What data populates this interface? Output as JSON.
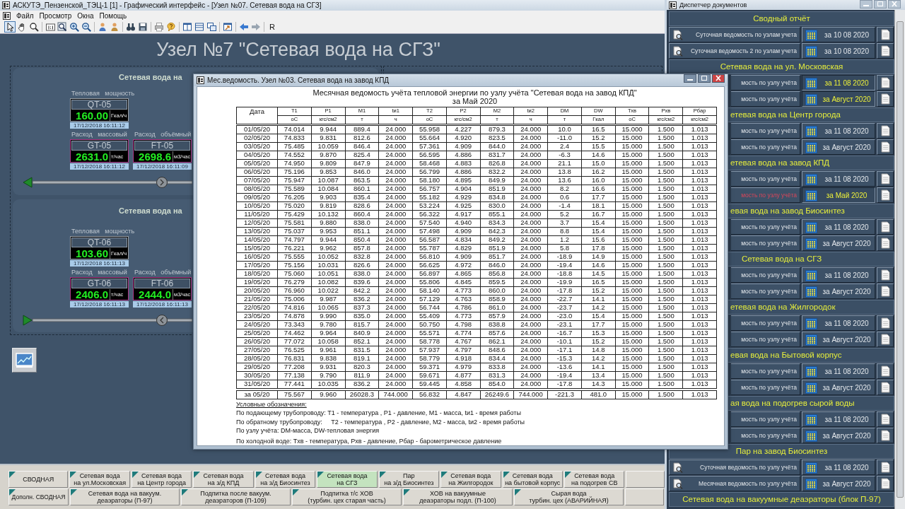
{
  "main_window": {
    "title": "АСКУТЭ_Пензенской_ТЭЦ-1 [1] - Графический интерфейс - [Узел №07. Сетевая вода на СГЗ]",
    "menu": [
      "Файл",
      "Просмотр",
      "Окна",
      "Помощь"
    ],
    "toolbar": [
      [
        {
          "kind": "pointer",
          "selected": true
        },
        {
          "kind": "hand",
          "selected": false
        },
        {
          "kind": "zoom",
          "selected": false
        }
      ],
      [
        {
          "kind": "actual",
          "selected": false
        },
        {
          "kind": "fit",
          "selected": false
        },
        {
          "kind": "zoom_in",
          "selected": false
        },
        {
          "kind": "zoom_out",
          "selected": false
        }
      ],
      [
        {
          "kind": "user_up",
          "selected": false
        },
        {
          "kind": "user_down",
          "selected": false
        }
      ],
      [
        {
          "kind": "binoculars",
          "selected": false
        },
        {
          "kind": "save",
          "selected": false
        }
      ],
      [
        {
          "kind": "print",
          "selected": false
        },
        {
          "kind": "help",
          "selected": false
        }
      ],
      [
        {
          "kind": "split_v",
          "selected": false
        },
        {
          "kind": "split_h",
          "selected": false
        },
        {
          "kind": "windows",
          "selected": false
        }
      ],
      [
        {
          "kind": "check",
          "selected": false
        }
      ],
      [
        {
          "kind": "back",
          "selected": false
        },
        {
          "kind": "forward",
          "selected": false
        }
      ]
    ],
    "toolbar_text_button": "R",
    "heading": "Узел №7 \"Сетевая вода на СГЗ\"",
    "panels": [
      {
        "heading": "Сетевая вода на",
        "kind": "leftward",
        "meters": [
          {
            "kind": "power",
            "caption": "Тепловая   мощность",
            "tag": "QT-05",
            "value": "160.00",
            "unit": "Гкал/ч",
            "time": "17/12/2018 16:11:12"
          },
          {
            "kind": "flow",
            "caption": "Расход   массовый",
            "tag": "GT-05",
            "value": "2631.0",
            "unit": "т/час",
            "time": "17/12/2018 16:11:12"
          },
          {
            "kind": "flow",
            "caption": "Расход   объёмный",
            "tag": "FT-05",
            "value": "2698.6",
            "unit": "м3/час",
            "time": "17/12/2018 16:11:09"
          }
        ]
      },
      {
        "heading": "Сетевая вода на",
        "kind": "rightward",
        "meters": [
          {
            "kind": "power",
            "caption": "Тепловая   мощность",
            "tag": "QT-06",
            "value": "103.60",
            "unit": "Гкал/ч",
            "time": "17/12/2018 16:11:13"
          },
          {
            "kind": "flow",
            "caption": "Расход   массовый",
            "tag": "GT-06",
            "value": "2406.0",
            "unit": "т/час",
            "time": "17/12/2018 16:11:13"
          },
          {
            "kind": "flow",
            "caption": "Расход   объёмный",
            "tag": "FT-06",
            "value": "2444.0",
            "unit": "м3/час",
            "time": "17/12/2018 16:11:13"
          }
        ]
      }
    ],
    "tab_rows": [
      [
        {
          "label": "СВОДНАЯ",
          "selected": false
        },
        {
          "label": "Сетевая вода\nна ул.Московская",
          "selected": false
        },
        {
          "label": "Сетевая вода\nна Центр города",
          "selected": false
        },
        {
          "label": "Сетевая вода\nна з/д КПД",
          "selected": false
        },
        {
          "label": "Сетевая вода\nна з/д Биосинтез",
          "selected": false
        },
        {
          "label": "Сетевая вода\nна СГЗ",
          "selected": true
        },
        {
          "label": "Пар\nна з/д Биосинтез",
          "selected": false
        },
        {
          "label": "Сетевая вода\nна Жилгородок",
          "selected": false
        },
        {
          "label": "Сетевая вода\nна бытовой корпус",
          "selected": false
        },
        {
          "label": "Сетевая вода\nна подогрев СВ",
          "selected": false
        }
      ],
      [
        {
          "label": "Дополн. СВОДНАЯ",
          "selected": false
        },
        {
          "label": "Сетевая вода на вакуум.\nдеаэраторы (П-97)",
          "selected": false
        },
        {
          "label": "Подпитка после вакуум.\nдеаэраторов (П-109)",
          "selected": false
        },
        {
          "label": "Подпитка т/с ХОВ\n(турбин. цех старая часть)",
          "selected": false
        },
        {
          "label": "ХОВ на вакуумные\nдеаэраторы подл. (П-100)",
          "selected": false
        },
        {
          "label": "Сырая вода\nтурбин. цех (АВАРИЙНАЯ)",
          "selected": false
        }
      ]
    ]
  },
  "report_window": {
    "title": "Мес.ведомость. Узел №03. Сетевая вода на завод КПД",
    "heading": "Месячная ведомость учёта тепловой энергии по узлу учёта \"Сетевая вода на завод КПД\"",
    "period": "за Май 2020",
    "columns": [
      {
        "name": "Дата"
      },
      {
        "name": "T1",
        "unit": "оС"
      },
      {
        "name": "P1",
        "unit": "кгс/см2"
      },
      {
        "name": "M1",
        "unit": "т"
      },
      {
        "name": "tи1",
        "unit": "ч"
      },
      {
        "name": "T2",
        "unit": "оС"
      },
      {
        "name": "P2",
        "unit": "кгс/см2"
      },
      {
        "name": "M2",
        "unit": "т"
      },
      {
        "name": "tи2",
        "unit": "ч"
      },
      {
        "name": "DM",
        "unit": "т"
      },
      {
        "name": "DW",
        "unit": "Гкал"
      },
      {
        "name": "Тхв",
        "unit": "оС"
      },
      {
        "name": "Рхв",
        "unit": "кгс/см2"
      },
      {
        "name": "Рбар",
        "unit": "кгс/см2"
      }
    ],
    "rows": [
      [
        "01/05/20",
        "74.014",
        "9.944",
        "889.4",
        "24.000",
        "55.958",
        "4.227",
        "879.3",
        "24.000",
        "10.0",
        "16.5",
        "15.000",
        "1.500",
        "1.013"
      ],
      [
        "02/05/20",
        "74.833",
        "9.831",
        "812.6",
        "24.000",
        "55.664",
        "4.920",
        "823.5",
        "24.000",
        "-11.0",
        "15.2",
        "15.000",
        "1.500",
        "1.013"
      ],
      [
        "03/05/20",
        "75.485",
        "10.059",
        "846.4",
        "24.000",
        "57.361",
        "4.909",
        "844.0",
        "24.000",
        "2.4",
        "15.5",
        "15.000",
        "1.500",
        "1.013"
      ],
      [
        "04/05/20",
        "74.552",
        "9.870",
        "825.4",
        "24.000",
        "56.595",
        "4.886",
        "831.7",
        "24.000",
        "-6.3",
        "14.6",
        "15.000",
        "1.500",
        "1.013"
      ],
      [
        "05/05/20",
        "74.950",
        "9.809",
        "847.9",
        "24.000",
        "58.468",
        "4.883",
        "826.8",
        "24.000",
        "21.1",
        "15.0",
        "15.000",
        "1.500",
        "1.013"
      ],
      [
        "06/05/20",
        "75.196",
        "9.853",
        "846.0",
        "24.000",
        "56.799",
        "4.886",
        "832.2",
        "24.000",
        "13.8",
        "16.2",
        "15.000",
        "1.500",
        "1.013"
      ],
      [
        "07/05/20",
        "75.947",
        "10.087",
        "863.5",
        "24.000",
        "58.180",
        "4.895",
        "849.9",
        "24.000",
        "13.6",
        "16.0",
        "15.000",
        "1.500",
        "1.013"
      ],
      [
        "08/05/20",
        "75.589",
        "10.084",
        "860.1",
        "24.000",
        "56.757",
        "4.904",
        "851.9",
        "24.000",
        "8.2",
        "16.6",
        "15.000",
        "1.500",
        "1.013"
      ],
      [
        "09/05/20",
        "76.205",
        "9.903",
        "835.4",
        "24.000",
        "55.182",
        "4.929",
        "834.8",
        "24.000",
        "0.6",
        "17.7",
        "15.000",
        "1.500",
        "1.013"
      ],
      [
        "10/05/20",
        "75.020",
        "9.819",
        "828.6",
        "24.000",
        "53.224",
        "4.925",
        "830.0",
        "24.000",
        "-1.4",
        "18.1",
        "15.000",
        "1.500",
        "1.013"
      ],
      [
        "11/05/20",
        "75.429",
        "10.132",
        "860.4",
        "24.000",
        "56.322",
        "4.917",
        "855.1",
        "24.000",
        "5.2",
        "16.7",
        "15.000",
        "1.500",
        "1.013"
      ],
      [
        "12/05/20",
        "75.581",
        "9.880",
        "838.0",
        "24.000",
        "57.540",
        "4.940",
        "834.3",
        "24.000",
        "3.7",
        "15.4",
        "15.000",
        "1.500",
        "1.013"
      ],
      [
        "13/05/20",
        "75.037",
        "9.953",
        "851.1",
        "24.000",
        "57.498",
        "4.909",
        "842.3",
        "24.000",
        "8.8",
        "15.4",
        "15.000",
        "1.500",
        "1.013"
      ],
      [
        "14/05/20",
        "74.797",
        "9.944",
        "850.4",
        "24.000",
        "56.587",
        "4.834",
        "849.2",
        "24.000",
        "1.2",
        "15.6",
        "15.000",
        "1.500",
        "1.013"
      ],
      [
        "15/05/20",
        "76.221",
        "9.962",
        "857.8",
        "24.000",
        "55.787",
        "4.829",
        "851.9",
        "24.000",
        "5.8",
        "17.8",
        "15.000",
        "1.500",
        "1.013"
      ],
      [
        "16/05/20",
        "75.555",
        "10.052",
        "832.8",
        "24.000",
        "56.810",
        "4.909",
        "851.7",
        "24.000",
        "-18.9",
        "14.9",
        "15.000",
        "1.500",
        "1.013"
      ],
      [
        "17/05/20",
        "75.156",
        "10.031",
        "826.6",
        "24.000",
        "56.625",
        "4.972",
        "846.0",
        "24.000",
        "-19.4",
        "14.6",
        "15.000",
        "1.500",
        "1.013"
      ],
      [
        "18/05/20",
        "75.060",
        "10.051",
        "838.0",
        "24.000",
        "56.897",
        "4.865",
        "856.8",
        "24.000",
        "-18.8",
        "14.5",
        "15.000",
        "1.500",
        "1.013"
      ],
      [
        "19/05/20",
        "76.279",
        "10.082",
        "839.6",
        "24.000",
        "55.806",
        "4.845",
        "859.5",
        "24.000",
        "-19.9",
        "16.5",
        "15.000",
        "1.500",
        "1.013"
      ],
      [
        "20/05/20",
        "76.960",
        "10.022",
        "842.2",
        "24.000",
        "58.140",
        "4.773",
        "860.0",
        "24.000",
        "-17.8",
        "15.2",
        "15.000",
        "1.500",
        "1.013"
      ],
      [
        "21/05/20",
        "75.006",
        "9.987",
        "836.2",
        "24.000",
        "57.129",
        "4.763",
        "858.9",
        "24.000",
        "-22.7",
        "14.1",
        "15.000",
        "1.500",
        "1.013"
      ],
      [
        "22/05/20",
        "74.816",
        "10.065",
        "837.3",
        "24.000",
        "56.744",
        "4.786",
        "861.0",
        "24.000",
        "-23.7",
        "14.2",
        "15.000",
        "1.500",
        "1.013"
      ],
      [
        "23/05/20",
        "74.878",
        "9.990",
        "835.0",
        "24.000",
        "55.409",
        "4.773",
        "857.9",
        "24.000",
        "-23.0",
        "15.4",
        "15.000",
        "1.500",
        "1.013"
      ],
      [
        "24/05/20",
        "73.343",
        "9.780",
        "815.7",
        "24.000",
        "50.750",
        "4.798",
        "838.8",
        "24.000",
        "-23.1",
        "17.7",
        "15.000",
        "1.500",
        "1.013"
      ],
      [
        "25/05/20",
        "74.462",
        "9.964",
        "840.9",
        "24.000",
        "55.571",
        "4.774",
        "857.6",
        "24.000",
        "-16.7",
        "15.3",
        "15.000",
        "1.500",
        "1.013"
      ],
      [
        "26/05/20",
        "77.072",
        "10.058",
        "852.1",
        "24.000",
        "58.778",
        "4.767",
        "862.1",
        "24.000",
        "-10.1",
        "15.2",
        "15.000",
        "1.500",
        "1.013"
      ],
      [
        "27/05/20",
        "76.525",
        "9.961",
        "831.5",
        "24.000",
        "57.937",
        "4.797",
        "848.6",
        "24.000",
        "-17.1",
        "14.8",
        "15.000",
        "1.500",
        "1.013"
      ],
      [
        "28/05/20",
        "76.831",
        "9.838",
        "819.1",
        "24.000",
        "58.779",
        "4.918",
        "834.4",
        "24.000",
        "-15.3",
        "14.2",
        "15.000",
        "1.500",
        "1.013"
      ],
      [
        "29/05/20",
        "77.208",
        "9.931",
        "820.3",
        "24.000",
        "59.371",
        "4.979",
        "833.8",
        "24.000",
        "-13.6",
        "14.1",
        "15.000",
        "1.500",
        "1.013"
      ],
      [
        "30/05/20",
        "77.138",
        "9.790",
        "811.9",
        "24.000",
        "59.671",
        "4.877",
        "831.3",
        "24.000",
        "-19.4",
        "13.4",
        "15.000",
        "1.500",
        "1.013"
      ],
      [
        "31/05/20",
        "77.441",
        "10.035",
        "836.2",
        "24.000",
        "59.445",
        "4.858",
        "854.0",
        "24.000",
        "-17.8",
        "14.3",
        "15.000",
        "1.500",
        "1.013"
      ]
    ],
    "total": [
      "за 05/20",
      "75.567",
      "9.960",
      "26028.3",
      "744.000",
      "56.832",
      "4.847",
      "26249.6",
      "744.000",
      "-221.3",
      "481.0",
      "15.000",
      "1.500",
      "1.013"
    ],
    "legend_title": "Условные обозначения:",
    "legend": [
      "По подающему трубопроводу: T1 - температура , P1 - давление, M1 - масса, tи1 - время работы",
      "По обратному трубопроводу:     T2 - температура , P2 - давление, M2 - масса, tи2 - время работы",
      "По узлу учёта: DM-масса, DW-тепловая энергия",
      "По холодной воде: Txв - температура, Pxв - давление, Pбар - барометрическое давление"
    ]
  },
  "document_manager": {
    "title": "Диспетчер документов",
    "sections": [
      {
        "kind": "full",
        "heading": "Сводный отчёт",
        "rows": [
          {
            "kind": "full",
            "label": "Суточная ведомость по узлам учета",
            "date": "за 10 08 2020",
            "highlighted": false,
            "selected": false
          },
          {
            "kind": "full",
            "label": "Суточная ведомость 2 по узлам учета",
            "date": "за 10 08 2020",
            "highlighted": false,
            "selected": false
          }
        ]
      },
      {
        "kind": "full",
        "heading": "Сетевая вода на ул. Московская",
        "rows": [
          {
            "kind": "clipped",
            "label": "мость по узлу учёта",
            "date": "за 11 08 2020",
            "highlighted": true,
            "selected": false
          },
          {
            "kind": "clipped",
            "label": "мость по узлу учёта",
            "date": "за Август 2020",
            "highlighted": true,
            "selected": false
          }
        ]
      },
      {
        "kind": "clipped",
        "heading": "етевая вода на Центр города",
        "rows": [
          {
            "kind": "clipped",
            "label": "мость по узлу учёта",
            "date": "за 11 08 2020",
            "highlighted": false,
            "selected": false
          },
          {
            "kind": "clipped",
            "label": "мость по узлу учёта",
            "date": "за Август 2020",
            "highlighted": false,
            "selected": false
          }
        ]
      },
      {
        "kind": "clipped",
        "heading": "етевая вода на завод КПД",
        "rows": [
          {
            "kind": "clipped",
            "label": "мость по узлу учёта",
            "date": "за 11 08 2020",
            "highlighted": false,
            "selected": false
          },
          {
            "kind": "clipped",
            "label": "мость по узлу учёта",
            "date": "за Май 2020",
            "highlighted": true,
            "selected": true
          }
        ]
      },
      {
        "kind": "clipped",
        "heading": "евая вода на завод Биосинтез",
        "rows": [
          {
            "kind": "clipped",
            "label": "мость по узлу учёта",
            "date": "за 11 08 2020",
            "highlighted": false,
            "selected": false
          },
          {
            "kind": "clipped",
            "label": "мость по узлу учёта",
            "date": "за Август 2020",
            "highlighted": false,
            "selected": false
          }
        ]
      },
      {
        "kind": "full",
        "heading": "Сетевая вода на СГЗ",
        "rows": [
          {
            "kind": "clipped",
            "label": "мость по узлу учёта",
            "date": "за 11 08 2020",
            "highlighted": false,
            "selected": false
          },
          {
            "kind": "clipped",
            "label": "мость по узлу учёта",
            "date": "за Август 2020",
            "highlighted": false,
            "selected": false
          }
        ]
      },
      {
        "kind": "clipped",
        "heading": "етевая вода на Жилгородок",
        "rows": [
          {
            "kind": "clipped",
            "label": "мость по узлу учёта",
            "date": "за 11 08 2020",
            "highlighted": false,
            "selected": false
          },
          {
            "kind": "clipped",
            "label": "мость по узлу учёта",
            "date": "за Август 2020",
            "highlighted": false,
            "selected": false
          }
        ]
      },
      {
        "kind": "clipped",
        "heading": "евая вода на Бытовой корпус",
        "rows": [
          {
            "kind": "clipped",
            "label": "мость по узлу учёта",
            "date": "за 11 08 2020",
            "highlighted": false,
            "selected": false
          },
          {
            "kind": "clipped",
            "label": "мость по узлу учёта",
            "date": "за Август 2020",
            "highlighted": false,
            "selected": false
          }
        ]
      },
      {
        "kind": "clipped",
        "heading": "ая вода на подогрев сырой воды",
        "rows": [
          {
            "kind": "clipped",
            "label": "мость по узлу учёта",
            "date": "за 11 08 2020",
            "highlighted": false,
            "selected": false
          },
          {
            "kind": "clipped",
            "label": "мость по узлу учёта",
            "date": "за Август 2020",
            "highlighted": false,
            "selected": false
          }
        ]
      },
      {
        "kind": "full",
        "heading": "Пар на завод Биосинтез",
        "rows": [
          {
            "kind": "full",
            "label": "Суточная ведомость по узлу учёта",
            "date": "за 11 08 2020",
            "highlighted": false,
            "selected": false
          },
          {
            "kind": "full",
            "label": "Месячная ведомость по узлу учёта",
            "date": "за Август 2020",
            "highlighted": false,
            "selected": false
          }
        ]
      },
      {
        "kind": "full",
        "heading": "Сетевая вода на вакуумные деаэраторы (блок П-97)"
      }
    ]
  }
}
